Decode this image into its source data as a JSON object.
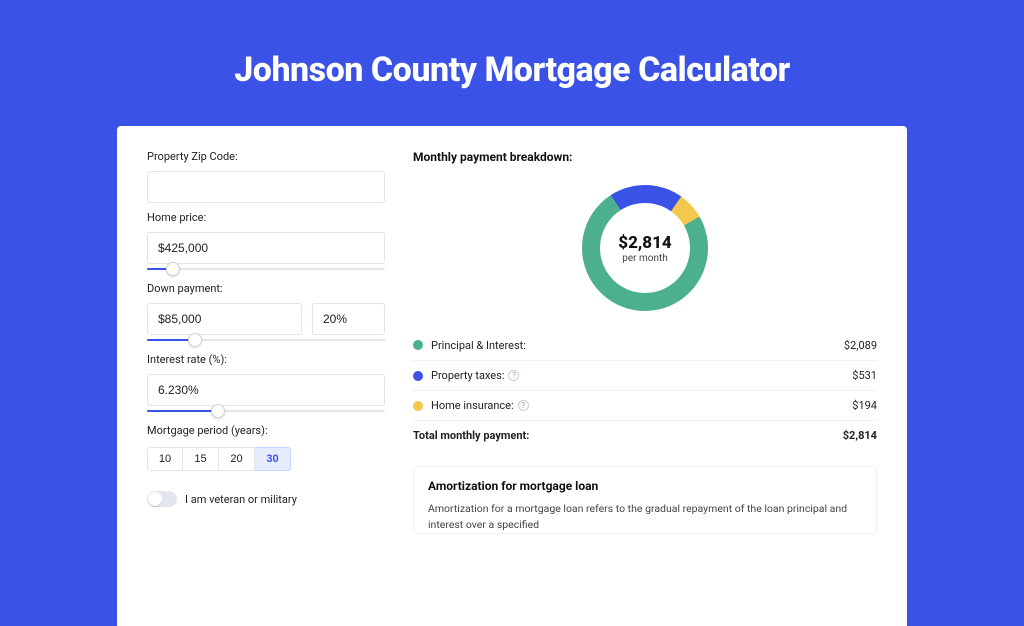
{
  "title": "Johnson County Mortgage Calculator",
  "colors": {
    "accent": "#3a52e6",
    "green": "#4caf8e",
    "blue": "#3a52e6",
    "yellow": "#f2c94c"
  },
  "form": {
    "zip_label": "Property Zip Code:",
    "zip_value": "",
    "home_price_label": "Home price:",
    "home_price_value": "$425,000",
    "home_price_slider_pct": 11,
    "down_payment_label": "Down payment:",
    "down_payment_amount": "$85,000",
    "down_payment_pct": "20%",
    "down_payment_slider_pct": 20,
    "rate_label": "Interest rate (%):",
    "rate_value": "6.230%",
    "rate_slider_pct": 30,
    "period_label": "Mortgage period (years):",
    "period_options": [
      "10",
      "15",
      "20",
      "30"
    ],
    "period_active_index": 3,
    "veteran_label": "I am veteran or military",
    "veteran_on": false
  },
  "breakdown": {
    "heading": "Monthly payment breakdown:",
    "center_value": "$2,814",
    "center_sub": "per month",
    "rows": [
      {
        "swatch": "#4caf8e",
        "label_text": "Principal & Interest:",
        "has_info": false,
        "value": "$2,089"
      },
      {
        "swatch": "#3a52e6",
        "label_text": "Property taxes:",
        "has_info": true,
        "value": "$531"
      },
      {
        "swatch": "#f2c94c",
        "label_text": "Home insurance:",
        "has_info": true,
        "value": "$194"
      }
    ],
    "total_label": "Total monthly payment:",
    "total_value": "$2,814"
  },
  "chart_data": {
    "type": "pie",
    "title": "Monthly payment breakdown",
    "categories": [
      "Principal & Interest",
      "Property taxes",
      "Home insurance"
    ],
    "values": [
      2089,
      531,
      194
    ],
    "total": 2814,
    "colors": [
      "#4caf8e",
      "#3a52e6",
      "#f2c94c"
    ]
  },
  "amortization": {
    "heading": "Amortization for mortgage loan",
    "body": "Amortization for a mortgage loan refers to the gradual repayment of the loan principal and interest over a specified"
  }
}
